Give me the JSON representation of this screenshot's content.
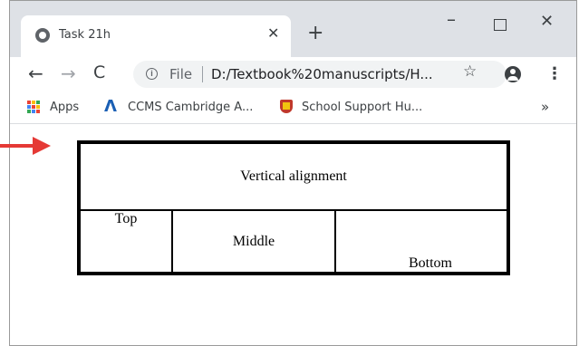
{
  "tab": {
    "title": "Task 21h"
  },
  "window_controls": {
    "minimize": "–",
    "maximize": "",
    "close": "×"
  },
  "toolbar": {
    "back": "←",
    "forward": "→",
    "reload": "C",
    "scheme": "File",
    "url": "D:/Textbook%20manuscripts/H...",
    "star": "☆",
    "menu": "⋮"
  },
  "bookmarks": {
    "items": [
      {
        "label": "Apps",
        "icon": "apps-grid-icon"
      },
      {
        "label": "CCMS Cambridge A...",
        "icon": "ccms-logo-icon"
      },
      {
        "label": "School Support Hu...",
        "icon": "shield-icon"
      }
    ],
    "more": "»"
  },
  "table": {
    "header": "Vertical alignment",
    "cells": [
      "Top",
      "Middle",
      "Bottom"
    ]
  },
  "colors": {
    "tabstrip": "#dee1e6",
    "arrow": "#e53935",
    "apps_dots": [
      "#ea4335",
      "#fbbc05",
      "#34a853",
      "#4285f4",
      "#ea4335",
      "#fbbc05",
      "#34a853",
      "#4285f4",
      "#ea4335"
    ]
  }
}
